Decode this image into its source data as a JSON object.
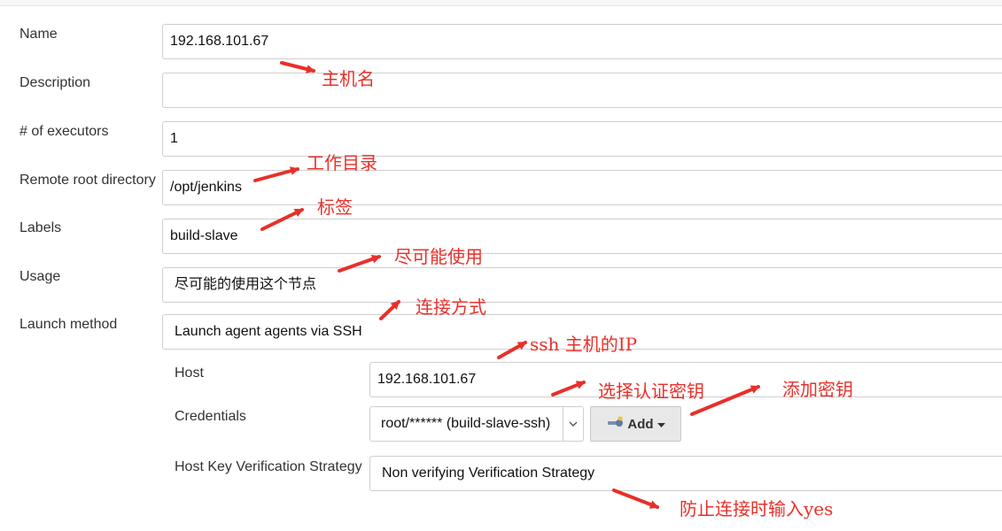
{
  "form": {
    "name": {
      "label": "Name",
      "value": "192.168.101.67"
    },
    "description": {
      "label": "Description",
      "value": ""
    },
    "executors": {
      "label": "# of executors",
      "value": "1"
    },
    "remote_root": {
      "label": "Remote root directory",
      "value": "/opt/jenkins"
    },
    "labels": {
      "label": "Labels",
      "value": "build-slave"
    },
    "usage": {
      "label": "Usage",
      "value": "尽可能的使用这个节点"
    },
    "launch_method": {
      "label": "Launch method",
      "value": "Launch agent agents via SSH"
    },
    "host": {
      "label": "Host",
      "value": "192.168.101.67"
    },
    "credentials": {
      "label": "Credentials",
      "value": "root/****** (build-slave-ssh)",
      "add_label": "Add"
    },
    "host_key": {
      "label": "Host Key Verification Strategy",
      "value": "Non verifying Verification Strategy"
    }
  },
  "annotations": {
    "hostname": "主机名",
    "workdir": "工作目录",
    "tag": "标签",
    "use_when_possible": "尽可能使用",
    "connect_method": "连接方式",
    "ssh_host_ip": "ssh 主机的IP",
    "select_credential": "选择认证密钥",
    "add_key": "添加密钥",
    "prevent_yes": "防止连接时输入yes"
  },
  "colors": {
    "annotation": "#e8302a"
  },
  "icons": {
    "add": "key-icon",
    "dropdown": "chevron-down-icon"
  }
}
